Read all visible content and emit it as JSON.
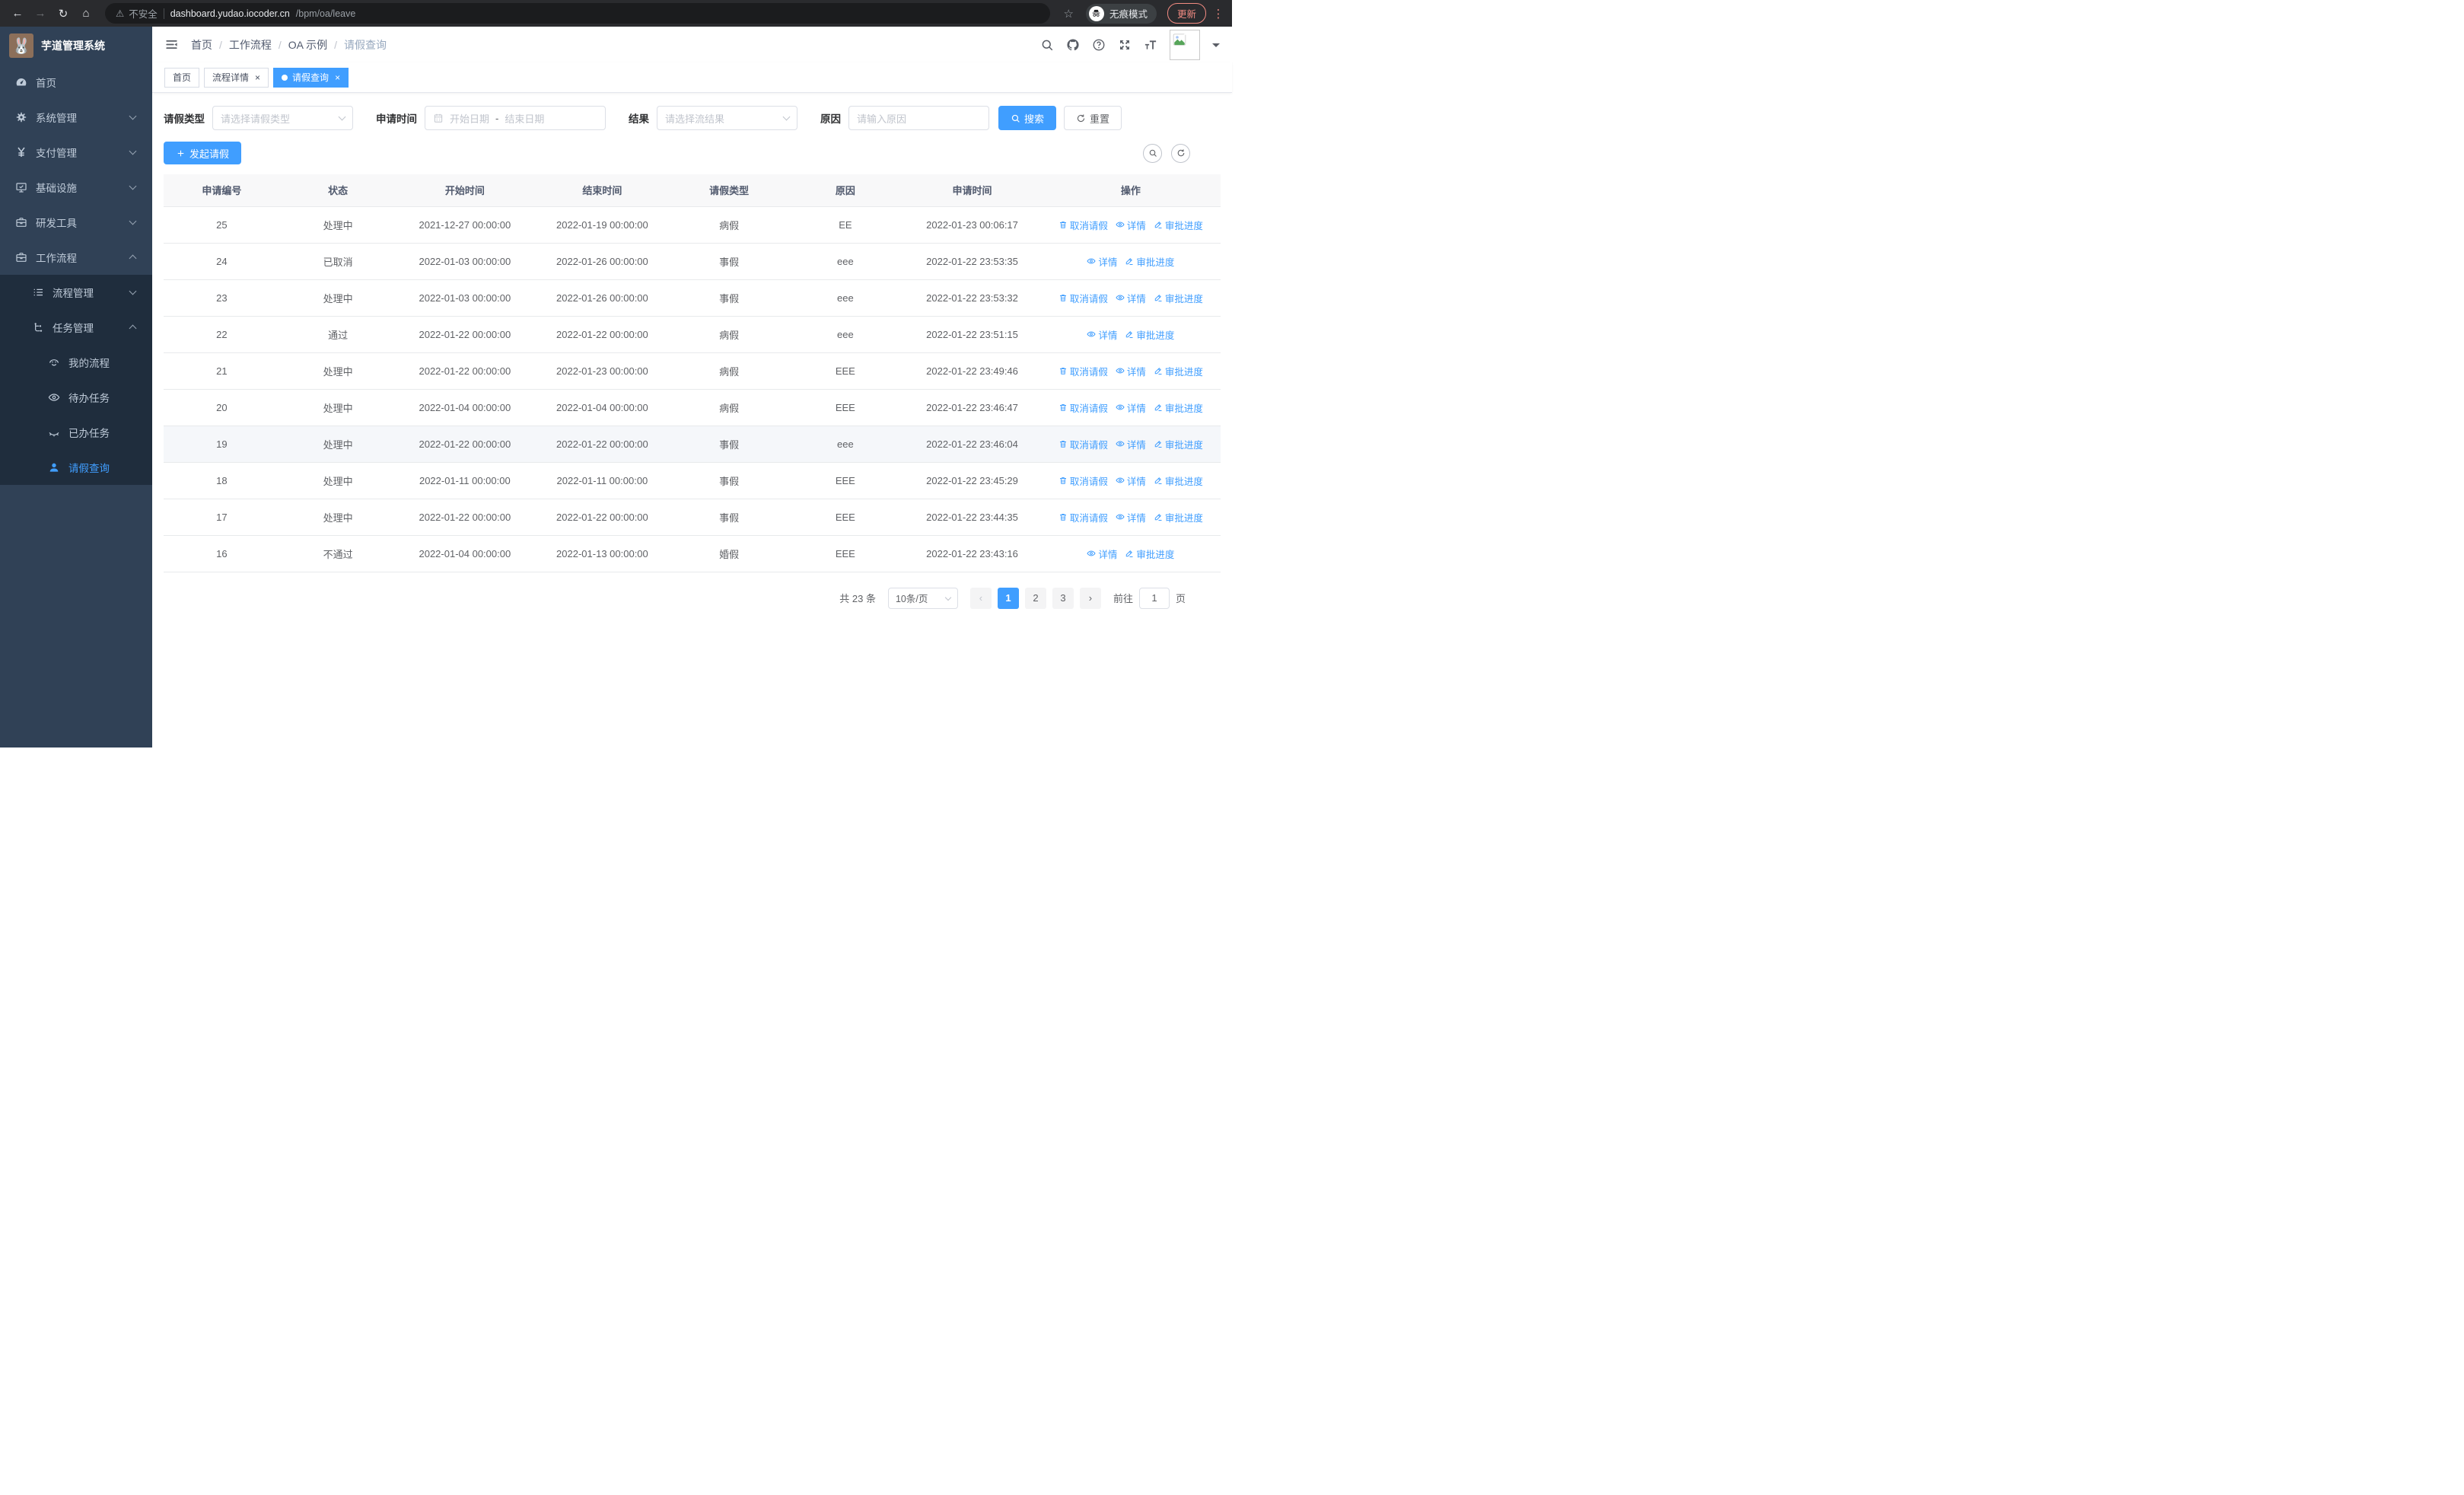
{
  "colors": {
    "accent": "#409eff",
    "sidebar_bg": "#304156",
    "submenu_bg": "#1f2d3d",
    "update_accent": "#f28b82",
    "table_header_bg": "#f8f8f9"
  },
  "browser": {
    "security_label": "不安全",
    "url_host": "dashboard.yudao.iocoder.cn",
    "url_path": "/bpm/oa/leave",
    "incognito_label": "无痕模式",
    "update_label": "更新",
    "back": "←",
    "forward": "→",
    "reload": "↻",
    "home": "⌂",
    "warning": "⚠",
    "star": "☆",
    "dots": "⋮"
  },
  "sidebar": {
    "title": "芋道管理系统",
    "logo_glyph": "🐰",
    "items": [
      {
        "id": "home",
        "icon": "gauge-icon",
        "label": "首页",
        "depth": 0
      },
      {
        "id": "system",
        "icon": "gear-icon",
        "label": "系统管理",
        "depth": 0,
        "chevron": "down"
      },
      {
        "id": "payment",
        "icon": "yen-icon",
        "label": "支付管理",
        "depth": 0,
        "chevron": "down"
      },
      {
        "id": "infra",
        "icon": "monitor-icon",
        "label": "基础设施",
        "depth": 0,
        "chevron": "down"
      },
      {
        "id": "devtools",
        "icon": "briefcase-icon",
        "label": "研发工具",
        "depth": 0,
        "chevron": "down"
      },
      {
        "id": "workflow",
        "icon": "briefcase-icon",
        "label": "工作流程",
        "depth": 0,
        "chevron": "up"
      },
      {
        "id": "process-mgmt",
        "icon": "list-icon",
        "label": "流程管理",
        "depth": 1,
        "chevron": "down",
        "in_submenu": true
      },
      {
        "id": "task-mgmt",
        "icon": "flow-icon",
        "label": "任务管理",
        "depth": 1,
        "chevron": "up",
        "in_submenu": true
      },
      {
        "id": "my-process",
        "icon": "face-icon",
        "label": "我的流程",
        "depth": 2,
        "in_submenu": true
      },
      {
        "id": "todo-tasks",
        "icon": "eye-icon",
        "label": "待办任务",
        "depth": 2,
        "in_submenu": true
      },
      {
        "id": "done-tasks",
        "icon": "eye-closed-icon",
        "label": "已办任务",
        "depth": 2,
        "in_submenu": true
      },
      {
        "id": "leave-query",
        "icon": "user-icon",
        "label": "请假查询",
        "depth": 2,
        "in_submenu": true,
        "active": true
      }
    ]
  },
  "navbar": {
    "breadcrumb": [
      "首页",
      "工作流程",
      "OA 示例",
      "请假查询"
    ],
    "icons": [
      "search-icon",
      "github-icon",
      "help-icon",
      "fullscreen-icon",
      "font-size-icon"
    ]
  },
  "tags": [
    {
      "label": "首页",
      "closable": false,
      "active": false
    },
    {
      "label": "流程详情",
      "closable": true,
      "active": false
    },
    {
      "label": "请假查询",
      "closable": true,
      "active": true
    }
  ],
  "filters": {
    "leave_type": {
      "label": "请假类型",
      "placeholder": "请选择请假类型"
    },
    "apply_time": {
      "label": "申请时间",
      "start_placeholder": "开始日期",
      "separator": "-",
      "end_placeholder": "结束日期"
    },
    "result": {
      "label": "结果",
      "placeholder": "请选择流结果"
    },
    "reason": {
      "label": "原因",
      "placeholder": "请输入原因"
    },
    "search_label": "搜索",
    "reset_label": "重置"
  },
  "toolbar": {
    "create_label": "发起请假"
  },
  "table": {
    "columns": [
      "申请编号",
      "状态",
      "开始时间",
      "结束时间",
      "请假类型",
      "原因",
      "申请时间",
      "操作"
    ],
    "action_labels": {
      "cancel": "取消请假",
      "detail": "详情",
      "progress": "审批进度"
    },
    "rows": [
      {
        "id": "25",
        "status": "处理中",
        "start": "2021-12-27 00:00:00",
        "end": "2022-01-19 00:00:00",
        "type": "病假",
        "reason": "EE",
        "applied": "2022-01-23 00:06:17",
        "actions": [
          "cancel",
          "detail",
          "progress"
        ]
      },
      {
        "id": "24",
        "status": "已取消",
        "start": "2022-01-03 00:00:00",
        "end": "2022-01-26 00:00:00",
        "type": "事假",
        "reason": "eee",
        "applied": "2022-01-22 23:53:35",
        "actions": [
          "detail",
          "progress"
        ]
      },
      {
        "id": "23",
        "status": "处理中",
        "start": "2022-01-03 00:00:00",
        "end": "2022-01-26 00:00:00",
        "type": "事假",
        "reason": "eee",
        "applied": "2022-01-22 23:53:32",
        "actions": [
          "cancel",
          "detail",
          "progress"
        ]
      },
      {
        "id": "22",
        "status": "通过",
        "start": "2022-01-22 00:00:00",
        "end": "2022-01-22 00:00:00",
        "type": "病假",
        "reason": "eee",
        "applied": "2022-01-22 23:51:15",
        "actions": [
          "detail",
          "progress"
        ]
      },
      {
        "id": "21",
        "status": "处理中",
        "start": "2022-01-22 00:00:00",
        "end": "2022-01-23 00:00:00",
        "type": "病假",
        "reason": "EEE",
        "applied": "2022-01-22 23:49:46",
        "actions": [
          "cancel",
          "detail",
          "progress"
        ]
      },
      {
        "id": "20",
        "status": "处理中",
        "start": "2022-01-04 00:00:00",
        "end": "2022-01-04 00:00:00",
        "type": "病假",
        "reason": "EEE",
        "applied": "2022-01-22 23:46:47",
        "actions": [
          "cancel",
          "detail",
          "progress"
        ]
      },
      {
        "id": "19",
        "status": "处理中",
        "start": "2022-01-22 00:00:00",
        "end": "2022-01-22 00:00:00",
        "type": "事假",
        "reason": "eee",
        "applied": "2022-01-22 23:46:04",
        "actions": [
          "cancel",
          "detail",
          "progress"
        ],
        "highlighted": true
      },
      {
        "id": "18",
        "status": "处理中",
        "start": "2022-01-11 00:00:00",
        "end": "2022-01-11 00:00:00",
        "type": "事假",
        "reason": "EEE",
        "applied": "2022-01-22 23:45:29",
        "actions": [
          "cancel",
          "detail",
          "progress"
        ]
      },
      {
        "id": "17",
        "status": "处理中",
        "start": "2022-01-22 00:00:00",
        "end": "2022-01-22 00:00:00",
        "type": "事假",
        "reason": "EEE",
        "applied": "2022-01-22 23:44:35",
        "actions": [
          "cancel",
          "detail",
          "progress"
        ]
      },
      {
        "id": "16",
        "status": "不通过",
        "start": "2022-01-04 00:00:00",
        "end": "2022-01-13 00:00:00",
        "type": "婚假",
        "reason": "EEE",
        "applied": "2022-01-22 23:43:16",
        "actions": [
          "detail",
          "progress"
        ]
      }
    ]
  },
  "pagination": {
    "total_label": "共 23 条",
    "page_size_label": "10条/页",
    "pages": [
      "1",
      "2",
      "3"
    ],
    "current": "1",
    "prev": "‹",
    "next": "›",
    "goto_label": "前往",
    "goto_value": "1",
    "goto_suffix": "页"
  }
}
